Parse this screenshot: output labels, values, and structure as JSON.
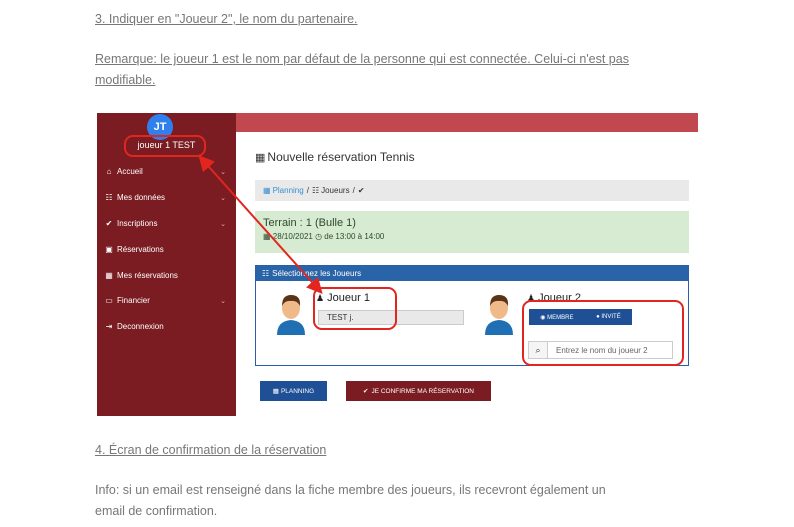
{
  "doc": {
    "step3": "3. Indiquer en \"Joueur 2\", le nom du partenaire.",
    "remark_line1": "Remarque: le joueur 1 est le nom par défaut de la personne qui est connectée. Celui-ci n'est pas",
    "remark_line2": "modifiable.",
    "step4": "4. Écran de confirmation de la réservation",
    "info_line1": "Info: si un email est renseigné dans la fiche membre des joueurs, ils recevront également un",
    "info_line2": "email de confirmation."
  },
  "app": {
    "avatar_initials": "JT",
    "user_name": "joueur 1 TEST",
    "sidebar": [
      {
        "icon": "⌂",
        "label": "Accueil",
        "has_chevron": true
      },
      {
        "icon": "☷",
        "label": "Mes données",
        "has_chevron": true
      },
      {
        "icon": "✔",
        "label": "Inscriptions",
        "has_chevron": true
      },
      {
        "icon": "▣",
        "label": "Réservations",
        "has_chevron": false
      },
      {
        "icon": "▦",
        "label": "Mes réservations",
        "has_chevron": false
      },
      {
        "icon": "▭",
        "label": "Financier",
        "has_chevron": true
      },
      {
        "icon": "⇥",
        "label": "Deconnexion",
        "has_chevron": false
      }
    ],
    "page_title": "Nouvelle réservation Tennis",
    "breadcrumb": {
      "planning": "Planning",
      "joueurs": "Joueurs",
      "sep": "/"
    },
    "terrain": {
      "title": "Terrain : 1 (Bulle 1)",
      "date": "28/10/2021",
      "time": "de 13:00 à 14:00"
    },
    "players_header": "Sélectionnez les Joueurs",
    "player1": {
      "label": "Joueur 1",
      "value": "TEST j."
    },
    "player2": {
      "label": "Joueur 2",
      "opt_member": "MEMBRE",
      "opt_guest": "INVITÉ",
      "placeholder": "Entrez le nom du joueur 2"
    },
    "btn_planning": "PLANNING",
    "btn_confirm": "JE CONFIRME MA RÉSERVATION"
  },
  "colors": {
    "sidebar": "#7a1c21",
    "primary": "#1f4f94",
    "highlight": "#e0261f"
  }
}
